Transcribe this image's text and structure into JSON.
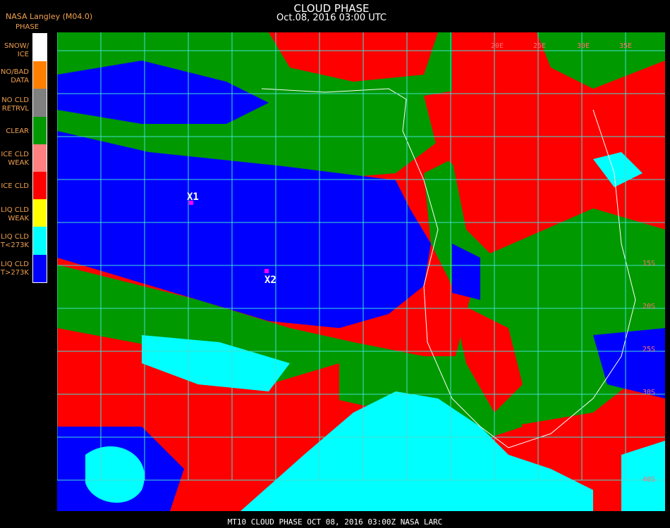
{
  "header": {
    "title": "CLOUD PHASE",
    "datetime": "Oct.08, 2016 03:00 UTC",
    "source": "NASA Langley (M04.0)"
  },
  "legend": {
    "title": "PHASE",
    "items": [
      {
        "label": "SNOW/\nICE",
        "color": "#ffffff"
      },
      {
        "label": "NO/BAD\nDATA",
        "color": "#ff8000"
      },
      {
        "label": "NO CLD\nRETRVL",
        "color": "#808080"
      },
      {
        "label": "CLEAR",
        "color": "#009900"
      },
      {
        "label": "ICE CLD\nWEAK",
        "color": "#ff8080"
      },
      {
        "label": "ICE CLD",
        "color": "#ff0000"
      },
      {
        "label": "LIQ CLD\nWEAK",
        "color": "#ffff00"
      },
      {
        "label": "LIQ CLD\nT<273K",
        "color": "#00ffff"
      },
      {
        "label": "LIQ CLD\nT>273K",
        "color": "#0000ff"
      }
    ]
  },
  "map": {
    "lon_labels": [
      "20E",
      "25E",
      "30E",
      "35E"
    ],
    "lat_labels": [
      "15S",
      "20S",
      "25S",
      "30S",
      "40S"
    ],
    "markers": [
      {
        "label": "X1"
      },
      {
        "label": "X2"
      }
    ]
  },
  "footer": {
    "text": "MT10   CLOUD PHASE    OCT 08, 2016 03:00Z   NASA LARC"
  }
}
